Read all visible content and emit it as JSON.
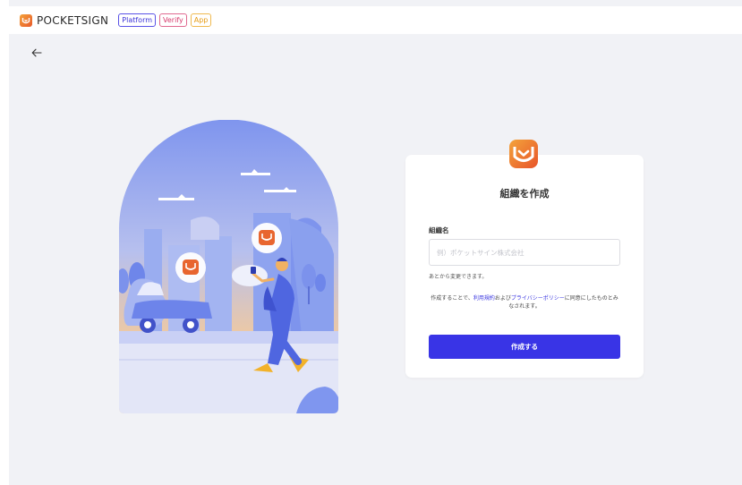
{
  "header": {
    "brand": "POCKETSIGN",
    "tags": {
      "platform": "Platform",
      "verify": "Verify",
      "app": "App"
    }
  },
  "colors": {
    "primary": "#3934e6",
    "brand_orange": "#e8592a",
    "verify_pink": "#d63b6d",
    "app_yellow": "#e69b14",
    "background": "#f1f2f6"
  },
  "nav": {
    "back_icon": "arrow-left-icon"
  },
  "form": {
    "title": "組織を作成",
    "org_name_label": "組織名",
    "org_name_placeholder": "例）ポケットサイン株式会社",
    "org_name_value": "",
    "help_text": "あとから変更できます。",
    "terms_prefix": "作成することで、",
    "terms_link": "利用規約",
    "terms_mid": "および",
    "privacy_link": "プライバシーポリシー",
    "terms_suffix": "に同意にしたものとみなされます。",
    "submit_label": "作成する"
  }
}
